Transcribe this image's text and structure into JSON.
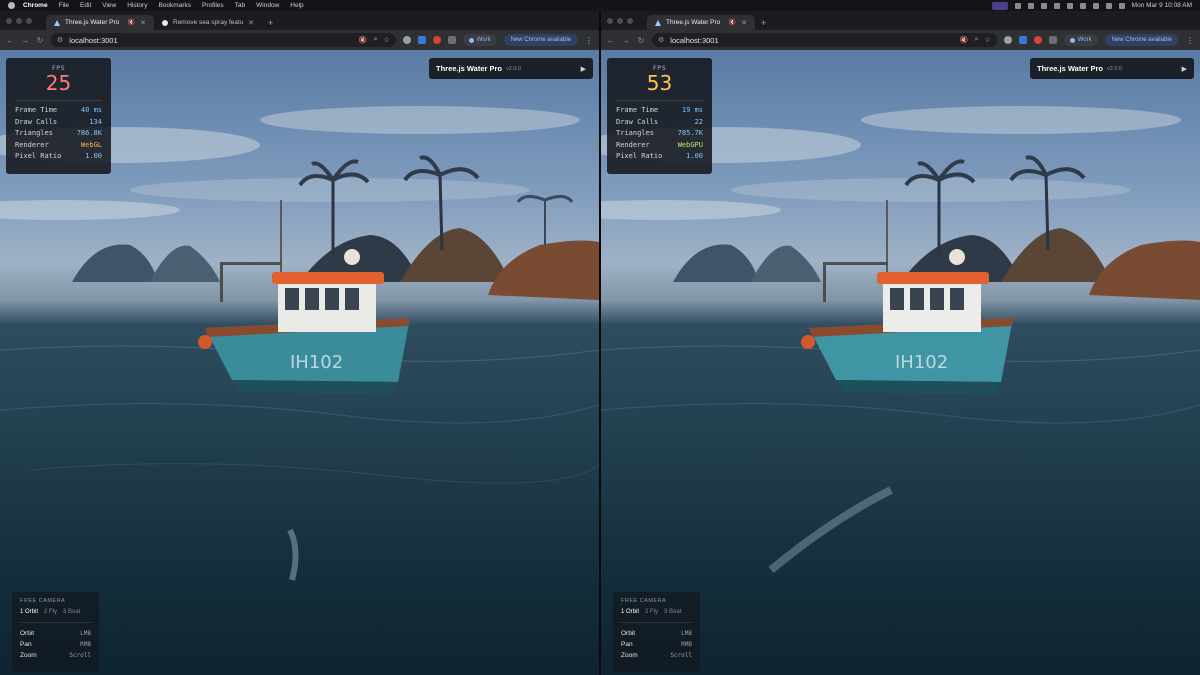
{
  "menubar": {
    "app": "Chrome",
    "items": [
      "File",
      "Edit",
      "View",
      "History",
      "Bookmarks",
      "Profiles",
      "Tab",
      "Window",
      "Help"
    ],
    "clock": "Mon Mar 9  10:08 AM"
  },
  "windows": [
    {
      "tabs": [
        {
          "title": "Three.js Water Pro",
          "active": true,
          "favicon": "threejs-icon"
        },
        {
          "title": "Remove sea spray feature b...",
          "active": false,
          "favicon": "github-icon"
        }
      ],
      "url": "localhost:3001",
      "profile": "Work",
      "update": "New Chrome available",
      "stats": {
        "fps_label": "FPS",
        "fps": "25",
        "fps_color": "#ff7a7a",
        "rows": [
          {
            "label": "Frame Time",
            "value": "40 ms",
            "color": "#7fc6ff"
          },
          {
            "label": "Draw Calls",
            "value": "134",
            "color": "#7fc6ff"
          },
          {
            "label": "Triangles",
            "value": "786.8K",
            "color": "#7fc6ff"
          },
          {
            "label": "Renderer",
            "value": "WebGL",
            "color": "#ffb04d"
          },
          {
            "label": "Pixel Ratio",
            "value": "1.00",
            "color": "#7fc6ff"
          }
        ]
      },
      "title_panel": {
        "title": "Three.js Water Pro",
        "version": "v2.0.0"
      },
      "camera": {
        "title": "FREE CAMERA",
        "modes": [
          {
            "label": "1 Orbit",
            "active": true
          },
          {
            "label": "2 Fly",
            "active": false
          },
          {
            "label": "3 Boat",
            "active": false
          }
        ],
        "controls": [
          {
            "action": "Orbit",
            "key": "LMB"
          },
          {
            "action": "Pan",
            "key": "RMB"
          },
          {
            "action": "Zoom",
            "key": "Scroll"
          }
        ]
      },
      "boat_label": "IH102"
    },
    {
      "tabs": [
        {
          "title": "Three.js Water Pro",
          "active": true,
          "favicon": "threejs-icon"
        }
      ],
      "url": "localhost:3001",
      "profile": "Work",
      "update": "New Chrome available",
      "stats": {
        "fps_label": "FPS",
        "fps": "53",
        "fps_color": "#ffc64d",
        "rows": [
          {
            "label": "Frame Time",
            "value": "19 ms",
            "color": "#7fc6ff"
          },
          {
            "label": "Draw Calls",
            "value": "22",
            "color": "#7fc6ff"
          },
          {
            "label": "Triangles",
            "value": "785.7K",
            "color": "#7fc6ff"
          },
          {
            "label": "Renderer",
            "value": "WebGPU",
            "color": "#b6e86a"
          },
          {
            "label": "Pixel Ratio",
            "value": "1.00",
            "color": "#7fc6ff"
          }
        ]
      },
      "title_panel": {
        "title": "Three.js Water Pro",
        "version": "v2.0.0"
      },
      "camera": {
        "title": "FREE CAMERA",
        "modes": [
          {
            "label": "1 Orbit",
            "active": true
          },
          {
            "label": "2 Fly",
            "active": false
          },
          {
            "label": "3 Boat",
            "active": false
          }
        ],
        "controls": [
          {
            "action": "Orbit",
            "key": "LMB"
          },
          {
            "action": "Pan",
            "key": "RMB"
          },
          {
            "action": "Zoom",
            "key": "Scroll"
          }
        ]
      },
      "boat_label": "IH102"
    }
  ]
}
